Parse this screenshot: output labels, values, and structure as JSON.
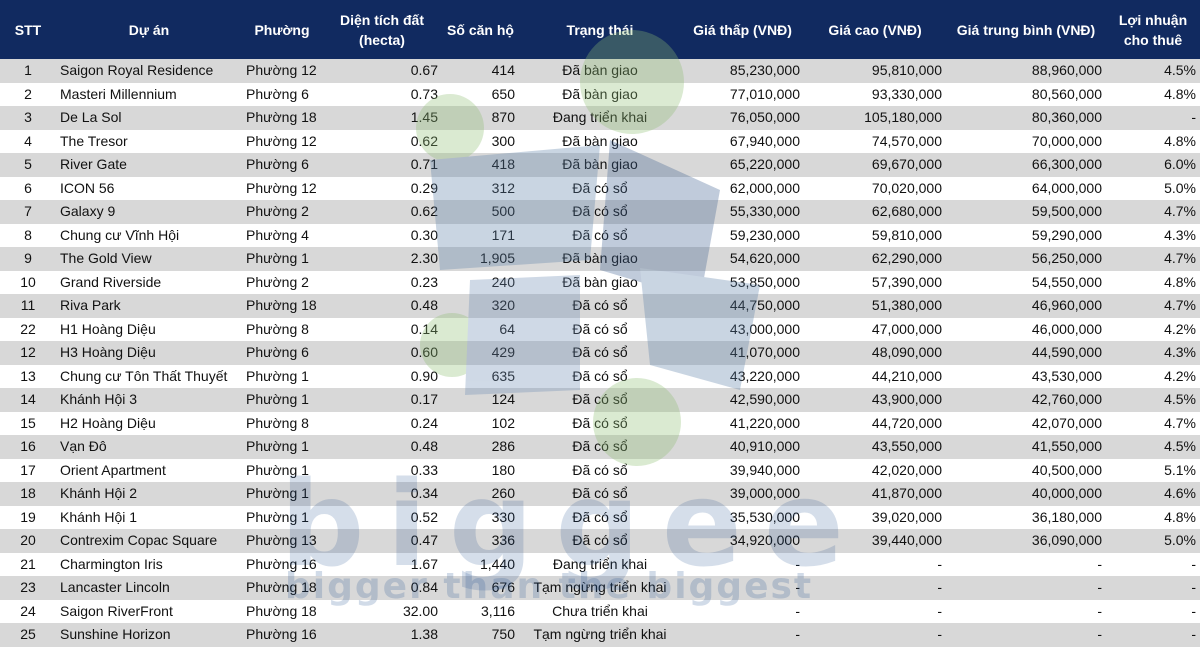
{
  "headers": [
    "STT",
    "Dự án",
    "Phường",
    "Diện tích đất (hecta)",
    "Số căn hộ",
    "Trạng thái",
    "Giá thấp (VNĐ)",
    "Giá cao (VNĐ)",
    "Giá trung bình (VNĐ)",
    "Lợi nhuận cho thuê"
  ],
  "rows": [
    [
      "1",
      "Saigon Royal Residence",
      "Phường 12",
      "0.67",
      "414",
      "Đã bàn giao",
      "85,230,000",
      "95,810,000",
      "88,960,000",
      "4.5%"
    ],
    [
      "2",
      "Masteri Millennium",
      "Phường 6",
      "0.73",
      "650",
      "Đã bàn giao",
      "77,010,000",
      "93,330,000",
      "80,560,000",
      "4.8%"
    ],
    [
      "3",
      "De La Sol",
      "Phường 18",
      "1.45",
      "870",
      "Đang triển khai",
      "76,050,000",
      "105,180,000",
      "80,360,000",
      "-"
    ],
    [
      "4",
      "The Tresor",
      "Phường 12",
      "0.62",
      "300",
      "Đã bàn giao",
      "67,940,000",
      "74,570,000",
      "70,000,000",
      "4.8%"
    ],
    [
      "5",
      "River Gate",
      "Phường 6",
      "0.71",
      "418",
      "Đã bàn giao",
      "65,220,000",
      "69,670,000",
      "66,300,000",
      "6.0%"
    ],
    [
      "6",
      "ICON 56",
      "Phường 12",
      "0.29",
      "312",
      "Đã có sổ",
      "62,000,000",
      "70,020,000",
      "64,000,000",
      "5.0%"
    ],
    [
      "7",
      "Galaxy 9",
      "Phường 2",
      "0.62",
      "500",
      "Đã có sổ",
      "55,330,000",
      "62,680,000",
      "59,500,000",
      "4.7%"
    ],
    [
      "8",
      "Chung cư Vĩnh Hội",
      "Phường 4",
      "0.30",
      "171",
      "Đã có sổ",
      "59,230,000",
      "59,810,000",
      "59,290,000",
      "4.3%"
    ],
    [
      "9",
      "The Gold View",
      "Phường 1",
      "2.30",
      "1,905",
      "Đã bàn giao",
      "54,620,000",
      "62,290,000",
      "56,250,000",
      "4.7%"
    ],
    [
      "10",
      "Grand Riverside",
      "Phường 2",
      "0.23",
      "240",
      "Đã bàn giao",
      "53,850,000",
      "57,390,000",
      "54,550,000",
      "4.8%"
    ],
    [
      "11",
      "Riva Park",
      "Phường 18",
      "0.48",
      "320",
      "Đã có sổ",
      "44,750,000",
      "51,380,000",
      "46,960,000",
      "4.7%"
    ],
    [
      "22",
      "H1 Hoàng Diệu",
      "Phường 8",
      "0.14",
      "64",
      "Đã có sổ",
      "43,000,000",
      "47,000,000",
      "46,000,000",
      "4.2%"
    ],
    [
      "12",
      "H3 Hoàng Diệu",
      "Phường 6",
      "0.60",
      "429",
      "Đã có sổ",
      "41,070,000",
      "48,090,000",
      "44,590,000",
      "4.3%"
    ],
    [
      "13",
      "Chung cư Tôn Thất Thuyết",
      "Phường 1",
      "0.90",
      "635",
      "Đã có sổ",
      "43,220,000",
      "44,210,000",
      "43,530,000",
      "4.2%"
    ],
    [
      "14",
      "Khánh Hội 3",
      "Phường 1",
      "0.17",
      "124",
      "Đã có sổ",
      "42,590,000",
      "43,900,000",
      "42,760,000",
      "4.5%"
    ],
    [
      "15",
      "H2 Hoàng Diệu",
      "Phường 8",
      "0.24",
      "102",
      "Đã có sổ",
      "41,220,000",
      "44,720,000",
      "42,070,000",
      "4.7%"
    ],
    [
      "16",
      "Vạn Đô",
      "Phường 1",
      "0.48",
      "286",
      "Đã có sổ",
      "40,910,000",
      "43,550,000",
      "41,550,000",
      "4.5%"
    ],
    [
      "17",
      "Orient Apartment",
      "Phường 1",
      "0.33",
      "180",
      "Đã có sổ",
      "39,940,000",
      "42,020,000",
      "40,500,000",
      "5.1%"
    ],
    [
      "18",
      "Khánh Hội 2",
      "Phường 1",
      "0.34",
      "260",
      "Đã có sổ",
      "39,000,000",
      "41,870,000",
      "40,000,000",
      "4.6%"
    ],
    [
      "19",
      "Khánh Hội 1",
      "Phường 1",
      "0.52",
      "330",
      "Đã có sổ",
      "35,530,000",
      "39,020,000",
      "36,180,000",
      "4.8%"
    ],
    [
      "20",
      "Contrexim Copac Square",
      "Phường 13",
      "0.47",
      "336",
      "Đã có sổ",
      "34,920,000",
      "39,440,000",
      "36,090,000",
      "5.0%"
    ],
    [
      "21",
      "Charmington Iris",
      "Phường 16",
      "1.67",
      "1,440",
      "Đang triển khai",
      "-",
      "-",
      "-",
      "-"
    ],
    [
      "23",
      "Lancaster Lincoln",
      "Phường 18",
      "0.84",
      "676",
      "Tạm ngừng triển khai",
      "-",
      "-",
      "-",
      "-"
    ],
    [
      "24",
      "Saigon RiverFront",
      "Phường 18",
      "32.00",
      "3,116",
      "Chưa triển khai",
      "-",
      "-",
      "-",
      "-"
    ],
    [
      "25",
      "Sunshine Horizon",
      "Phường 16",
      "1.38",
      "750",
      "Tạm ngừng triển khai",
      "-",
      "-",
      "-",
      "-"
    ]
  ],
  "watermark": {
    "logo_text": "biggee",
    "tagline": "bigger than the biggest"
  },
  "colors": {
    "header_bg": "#112a60",
    "header_text": "#ffffff",
    "row_odd": "#cdcdcd",
    "row_even": "#ffffff"
  }
}
